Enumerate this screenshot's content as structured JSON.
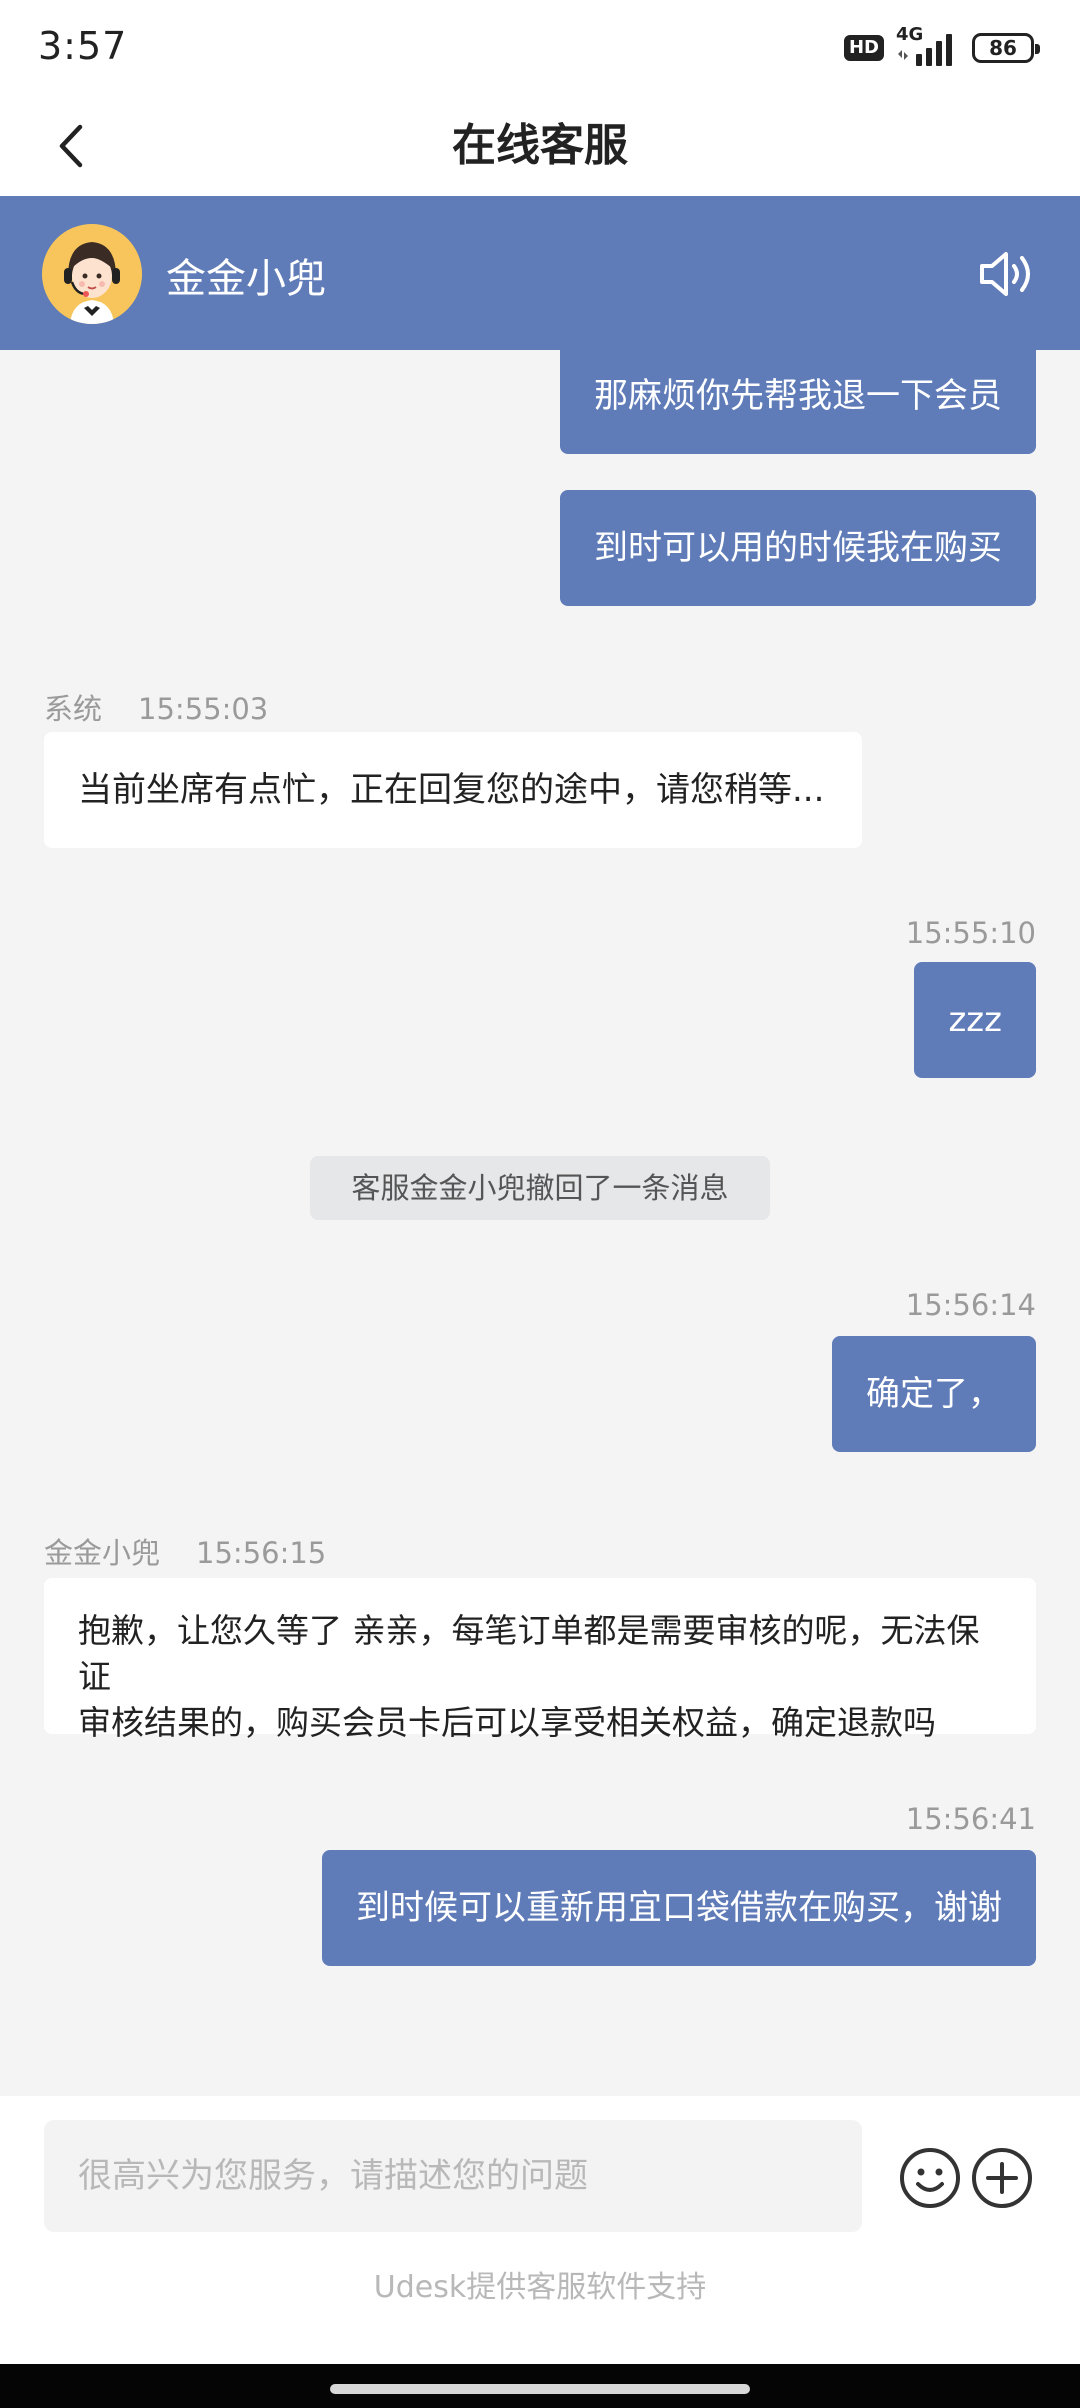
{
  "status_bar": {
    "time": "3:57",
    "hd": "HD",
    "network": "4G",
    "battery": "86"
  },
  "header": {
    "title": "在线客服",
    "back_icon": "chevron-left-icon"
  },
  "agent": {
    "name": "金金小兜",
    "avatar_icon": "customer-service-avatar",
    "speaker_icon": "speaker-icon"
  },
  "messages": {
    "m1": {
      "text": "那麻烦你先帮我退一下会员"
    },
    "m2": {
      "text": "到时可以用的时候我在购买"
    },
    "m3": {
      "sender": "系统",
      "time": "15:55:03",
      "text": "当前坐席有点忙，正在回复您的途中，请您稍等..."
    },
    "m4": {
      "time": "15:55:10",
      "text": "zzz"
    },
    "m5": {
      "text": "客服金金小兜撤回了一条消息"
    },
    "m6": {
      "time": "15:56:14",
      "text": "确定了，"
    },
    "m7": {
      "sender": "金金小兜",
      "time": "15:56:15",
      "line1": "抱歉，让您久等了 亲亲，每笔订单都是需要审核的呢，无法保证",
      "line2": "审核结果的，购买会员卡后可以享受相关权益，确定退款吗"
    },
    "m8": {
      "time": "15:56:41",
      "text": "到时候可以重新用宜口袋借款在购买，谢谢"
    }
  },
  "input": {
    "placeholder": "很高兴为您服务，请描述您的问题",
    "emoji_icon": "smiley-icon",
    "plus_icon": "plus-circle-icon"
  },
  "footer": {
    "powered_by": "Udesk提供客服软件支持"
  },
  "colors": {
    "brand": "#5f7cb8",
    "background": "#f4f4f5",
    "bubble_in": "#ffffff"
  }
}
